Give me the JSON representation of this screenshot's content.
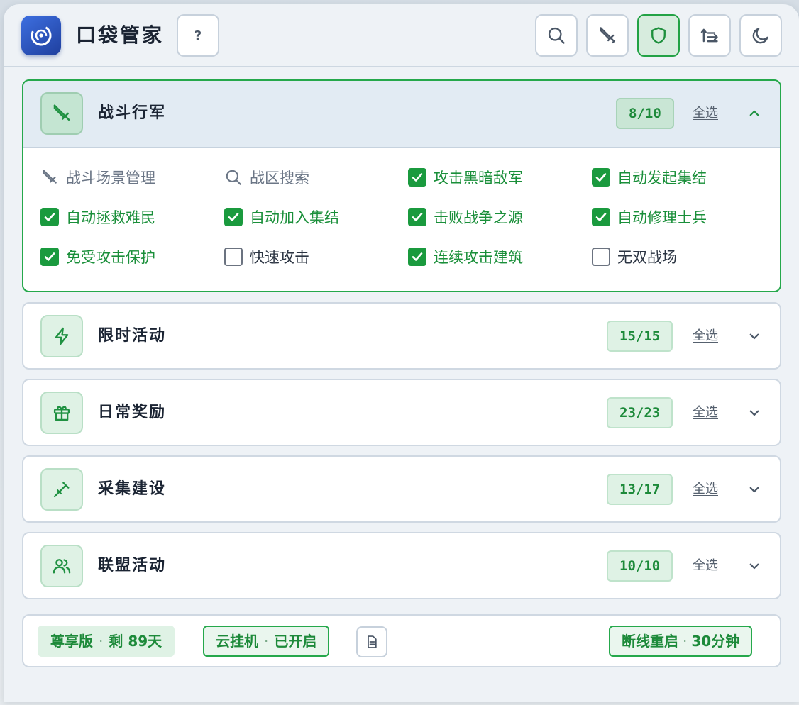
{
  "app": {
    "title": "口袋管家",
    "help_label": "?"
  },
  "header_buttons": [
    {
      "name": "search-icon",
      "active": false
    },
    {
      "name": "sword-icon",
      "active": false
    },
    {
      "name": "shield-icon",
      "active": true
    },
    {
      "name": "sort-icon",
      "active": false
    },
    {
      "name": "moon-icon",
      "active": false
    }
  ],
  "sections": {
    "battle": {
      "title": "战斗行军",
      "count": "8/10",
      "select_all": "全选",
      "expanded": true,
      "icon": "sword-icon",
      "options": [
        {
          "label": "战斗场景管理",
          "type": "icon",
          "icon": "sword-icon"
        },
        {
          "label": "战区搜索",
          "type": "icon",
          "icon": "search-icon"
        },
        {
          "label": "攻击黑暗敌军",
          "type": "checkbox",
          "checked": true
        },
        {
          "label": "自动发起集结",
          "type": "checkbox",
          "checked": true
        },
        {
          "label": "自动拯救难民",
          "type": "checkbox",
          "checked": true
        },
        {
          "label": "自动加入集结",
          "type": "checkbox",
          "checked": true
        },
        {
          "label": "击败战争之源",
          "type": "checkbox",
          "checked": true
        },
        {
          "label": "自动修理士兵",
          "type": "checkbox",
          "checked": true
        },
        {
          "label": "免受攻击保护",
          "type": "checkbox",
          "checked": true
        },
        {
          "label": "快速攻击",
          "type": "checkbox",
          "checked": false
        },
        {
          "label": "连续攻击建筑",
          "type": "checkbox",
          "checked": true
        },
        {
          "label": "无双战场",
          "type": "checkbox",
          "checked": false
        }
      ]
    },
    "limited": {
      "title": "限时活动",
      "count": "15/15",
      "select_all": "全选",
      "icon": "lightning-icon"
    },
    "daily": {
      "title": "日常奖励",
      "count": "23/23",
      "select_all": "全选",
      "icon": "gift-icon"
    },
    "gather": {
      "title": "采集建设",
      "count": "13/17",
      "select_all": "全选",
      "icon": "pickaxe-icon"
    },
    "alliance": {
      "title": "联盟活动",
      "count": "10/10",
      "select_all": "全选",
      "icon": "users-icon"
    }
  },
  "footer": {
    "vip_edition": "尊享版",
    "vip_remaining": "剩 89天",
    "cloud_label": "云挂机",
    "cloud_status": "已开启",
    "restart_label": "断线重启",
    "restart_value": "30分钟",
    "separator": "·"
  },
  "colors": {
    "accent_green": "#1a9a3e",
    "logo_blue": "#2f56c6",
    "border": "#cfd8e2"
  }
}
